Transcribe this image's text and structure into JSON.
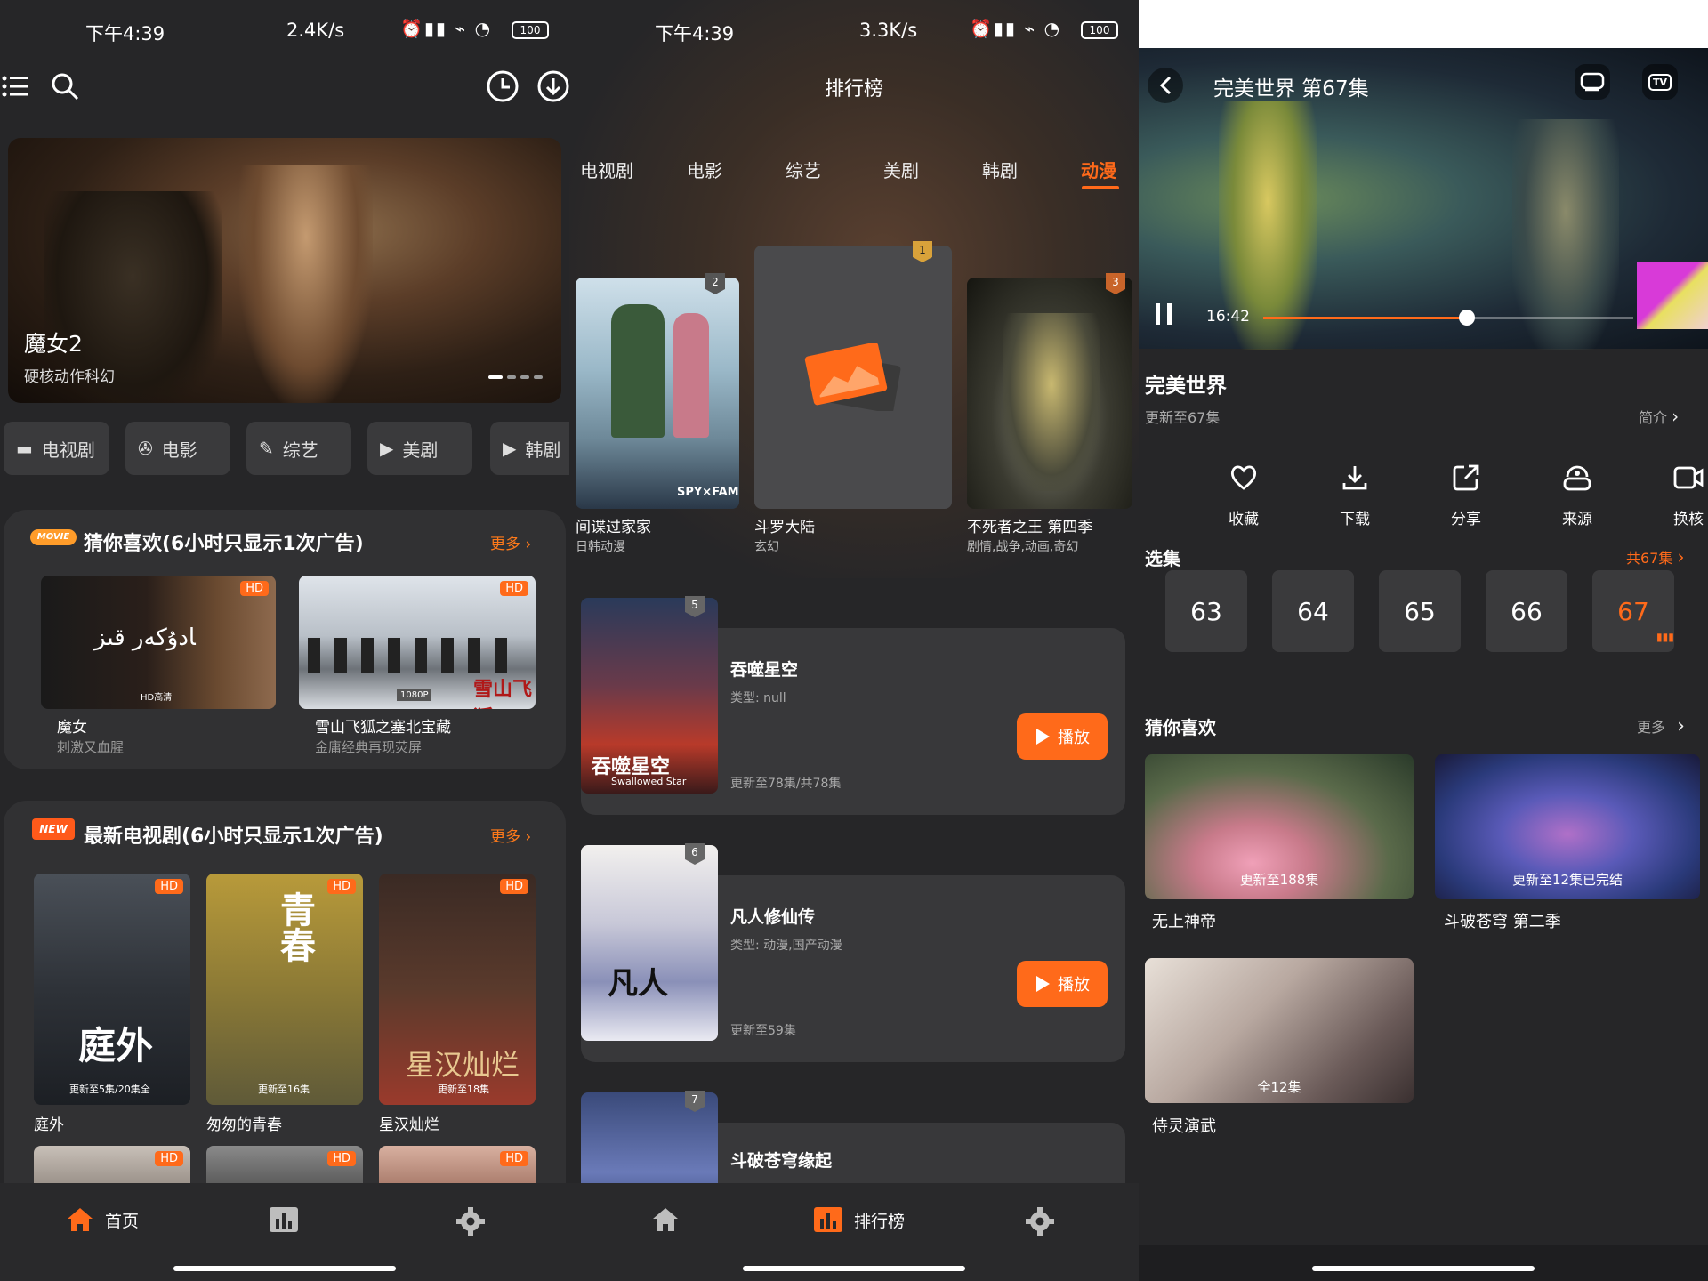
{
  "status_bar": [
    {
      "time": "下午4:39",
      "speed": "2.4K/s",
      "battery": "100"
    },
    {
      "time": "下午4:39",
      "speed": "3.3K/s",
      "battery": "100"
    }
  ],
  "home": {
    "banner": {
      "title": "魔女2",
      "subtitle": "硬核动作科幻"
    },
    "categories": [
      "电视剧",
      "电影",
      "综艺",
      "美剧",
      "韩剧"
    ],
    "section1": {
      "tag": "MOVIE",
      "title": "猜你喜欢(6小时只显示1次广告)",
      "more": "更多",
      "items": [
        {
          "title": "魔女",
          "desc": "刺激又血腥",
          "badge": "HD",
          "overlay": "HD高清"
        },
        {
          "title": "雪山飞狐之塞北宝藏",
          "desc": "金庸经典再现荧屏",
          "badge": "HD",
          "overlay": "1080P"
        }
      ]
    },
    "section2": {
      "tag": "NEW",
      "title": "最新电视剧(6小时只显示1次广告)",
      "more": "更多",
      "items": [
        {
          "title": "庭外",
          "badge": "HD",
          "overlay": "更新至5集/20集全"
        },
        {
          "title": "匆匆的青春",
          "badge": "HD",
          "overlay": "更新至16集"
        },
        {
          "title": "星汉灿烂",
          "badge": "HD",
          "overlay": "更新至18集"
        }
      ],
      "row2_badges": [
        "HD",
        "HD",
        "HD"
      ]
    },
    "nav": {
      "home": "首页"
    }
  },
  "ranking": {
    "title": "排行榜",
    "tabs": [
      "电视剧",
      "电影",
      "综艺",
      "美剧",
      "韩剧",
      "动漫"
    ],
    "active_tab": "动漫",
    "podium": [
      {
        "rank": "2",
        "title": "间谍过家家",
        "desc": "日韩动漫"
      },
      {
        "rank": "1",
        "title": "斗罗大陆",
        "desc": "玄幻"
      },
      {
        "rank": "3",
        "title": "不死者之王 第四季",
        "desc": "剧情,战争,动画,奇幻"
      }
    ],
    "list": [
      {
        "rank": "5",
        "title": "吞噬星空",
        "type": "类型: null",
        "update": "更新至78集/共78集",
        "play": "播放"
      },
      {
        "rank": "6",
        "title": "凡人修仙传",
        "type": "类型: 动漫,国产动漫",
        "update": "更新至59集",
        "play": "播放"
      },
      {
        "rank": "7",
        "title": "斗破苍穹缘起"
      }
    ],
    "nav": {
      "ranking": "排行榜"
    }
  },
  "detail": {
    "player_title": "完美世界 第67集",
    "time": "16:42",
    "progress": 0.55,
    "tv_label": "TV",
    "show_title": "完美世界",
    "update": "更新至67集",
    "intro": "简介",
    "actions": [
      "收藏",
      "下载",
      "分享",
      "来源",
      "换核"
    ],
    "episodes_title": "选集",
    "episodes_total": "共67集",
    "episodes": [
      "63",
      "64",
      "65",
      "66",
      "67"
    ],
    "current_episode": "67",
    "recommend_title": "猜你喜欢",
    "recommend_more": "更多",
    "recommend": [
      {
        "title": "无上神帝",
        "overlay": "更新至188集"
      },
      {
        "title": "斗破苍穹 第二季",
        "overlay": "更新至12集已完结"
      },
      {
        "title": "侍灵演武",
        "overlay": "全12集"
      }
    ]
  },
  "colors": {
    "accent": "#ff6a1a",
    "bg": "#262628",
    "card": "#313133"
  }
}
